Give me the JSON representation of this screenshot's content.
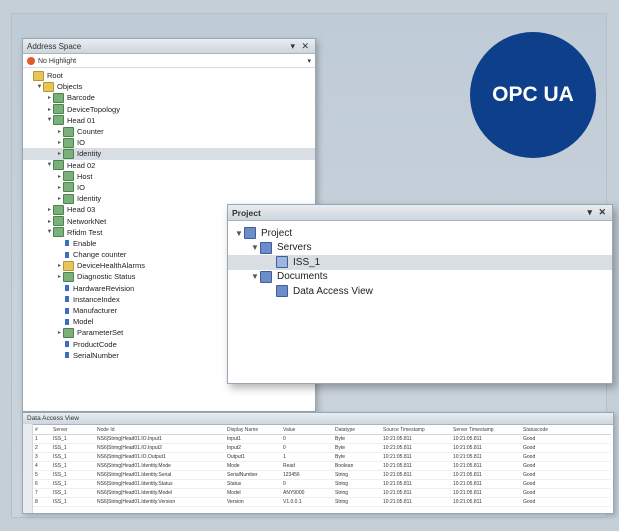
{
  "address_space": {
    "title": "Address Space",
    "highlight_label": "No Highlight",
    "nodes": [
      {
        "label": "Root",
        "depth": 0,
        "icon": "folder",
        "expander": ""
      },
      {
        "label": "Objects",
        "depth": 1,
        "icon": "folder",
        "expander": "▼"
      },
      {
        "label": "Barcode",
        "depth": 2,
        "icon": "object",
        "expander": "▸"
      },
      {
        "label": "DeviceTopology",
        "depth": 2,
        "icon": "object",
        "expander": "▸"
      },
      {
        "label": "Head 01",
        "depth": 2,
        "icon": "object",
        "expander": "▼"
      },
      {
        "label": "Counter",
        "depth": 3,
        "icon": "object",
        "expander": "▸"
      },
      {
        "label": "IO",
        "depth": 3,
        "icon": "object",
        "expander": "▸"
      },
      {
        "label": "Identity",
        "depth": 3,
        "icon": "object",
        "expander": "▸",
        "selected": true
      },
      {
        "label": "Head 02",
        "depth": 2,
        "icon": "object",
        "expander": "▼"
      },
      {
        "label": "Host",
        "depth": 3,
        "icon": "object",
        "expander": "▸"
      },
      {
        "label": "IO",
        "depth": 3,
        "icon": "object",
        "expander": "▸"
      },
      {
        "label": "Identity",
        "depth": 3,
        "icon": "object",
        "expander": "▸"
      },
      {
        "label": "Head 03",
        "depth": 2,
        "icon": "object",
        "expander": "▸"
      },
      {
        "label": "NetworkNet",
        "depth": 2,
        "icon": "object",
        "expander": "▸"
      },
      {
        "label": "Rfidm Test",
        "depth": 2,
        "icon": "object",
        "expander": "▼"
      },
      {
        "label": "Enable",
        "depth": 3,
        "icon": "variable",
        "expander": ""
      },
      {
        "label": "Change counter",
        "depth": 3,
        "icon": "variable",
        "expander": ""
      },
      {
        "label": "DeviceHealthAlarms",
        "depth": 3,
        "icon": "folder",
        "expander": "▸"
      },
      {
        "label": "Diagnostic Status",
        "depth": 3,
        "icon": "object",
        "expander": "▸"
      },
      {
        "label": "HardwareRevision",
        "depth": 3,
        "icon": "variable",
        "expander": ""
      },
      {
        "label": "InstanceIndex",
        "depth": 3,
        "icon": "variable",
        "expander": ""
      },
      {
        "label": "Manufacturer",
        "depth": 3,
        "icon": "variable",
        "expander": ""
      },
      {
        "label": "Model",
        "depth": 3,
        "icon": "variable",
        "expander": ""
      },
      {
        "label": "ParameterSet",
        "depth": 3,
        "icon": "object",
        "expander": "▸"
      },
      {
        "label": "ProductCode",
        "depth": 3,
        "icon": "variable",
        "expander": ""
      },
      {
        "label": "SerialNumber",
        "depth": 3,
        "icon": "variable",
        "expander": ""
      }
    ]
  },
  "project": {
    "title": "Project",
    "nodes": [
      {
        "label": "Project",
        "depth": 0,
        "expander": "▼",
        "icon": "project"
      },
      {
        "label": "Servers",
        "depth": 1,
        "expander": "▼",
        "icon": "folder"
      },
      {
        "label": "ISS_1",
        "depth": 2,
        "expander": "",
        "icon": "server",
        "selected": true
      },
      {
        "label": "Documents",
        "depth": 1,
        "expander": "▼",
        "icon": "folder"
      },
      {
        "label": "Data Access View",
        "depth": 2,
        "expander": "",
        "icon": "document"
      }
    ]
  },
  "attributes": {
    "title": "Data Access View",
    "columns": [
      "#",
      "Server",
      "Node Id",
      "Display Name",
      "Value",
      "Datatype",
      "Source Timestamp",
      "Server Timestamp",
      "Statuscode"
    ],
    "rows": [
      [
        "1",
        "ISS_1",
        "NS6|String|Head01.IO.Input1",
        "Input1",
        "0",
        "Byte",
        "10:21:05.811",
        "10:21:05.811",
        "Good"
      ],
      [
        "2",
        "ISS_1",
        "NS6|String|Head01.IO.Input2",
        "Input2",
        "0",
        "Byte",
        "10:21:05.811",
        "10:21:05.811",
        "Good"
      ],
      [
        "3",
        "ISS_1",
        "NS6|String|Head01.IO.Output1",
        "Output1",
        "1",
        "Byte",
        "10:21:05.811",
        "10:21:05.811",
        "Good"
      ],
      [
        "4",
        "ISS_1",
        "NS6|String|Head01.Identity.Mode",
        "Mode",
        "Read",
        "Boolean",
        "10:21:05.811",
        "10:21:05.811",
        "Good"
      ],
      [
        "5",
        "ISS_1",
        "NS6|String|Head01.Identity.Serial",
        "SerialNumber",
        "123456",
        "String",
        "10:21:05.811",
        "10:21:05.811",
        "Good"
      ],
      [
        "6",
        "ISS_1",
        "NS6|String|Head01.Identity.Status",
        "Status",
        "0",
        "String",
        "10:21:05.811",
        "10:21:05.811",
        "Good"
      ],
      [
        "7",
        "ISS_1",
        "NS6|String|Head01.Identity.Model",
        "Model",
        "ANY9000",
        "String",
        "10:21:05.811",
        "10:21:05.811",
        "Good"
      ],
      [
        "8",
        "ISS_1",
        "NS6|String|Head01.Identity.Version",
        "Version",
        "V1.0.0.1",
        "String",
        "10:21:05.811",
        "10:21:05.811",
        "Good"
      ]
    ]
  },
  "badge": {
    "label": "OPC UA",
    "color": "#0e3f8a"
  }
}
